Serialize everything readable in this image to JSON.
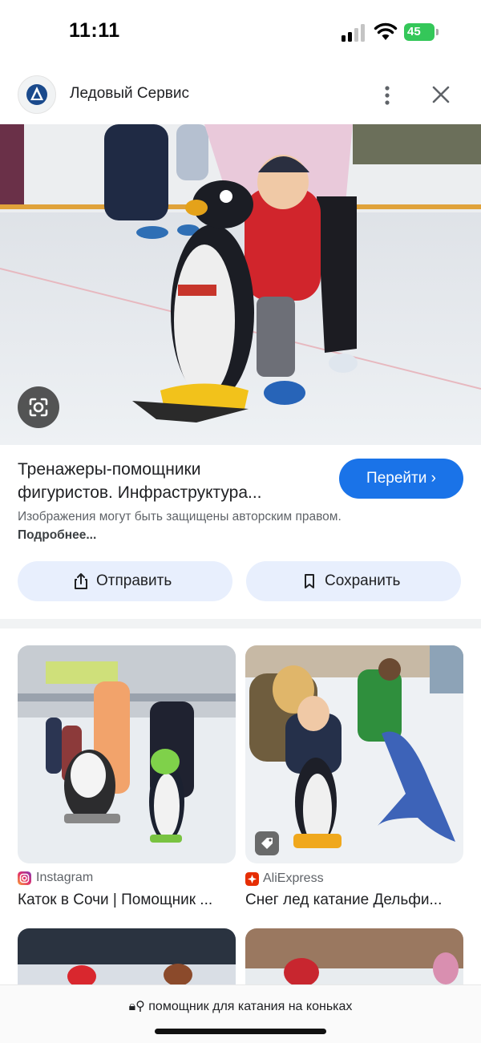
{
  "status_bar": {
    "time": "11:11",
    "battery": "45"
  },
  "header": {
    "site_name": "Ледовый Сервис"
  },
  "result": {
    "title_line1": "Тренажеры-помощники",
    "title_line2": "фигуристов. Инфраструктура...",
    "go_label": "Перейти",
    "copyright_text": "Изображения могут быть защищены авторским правом.",
    "learn_more": "Подробнее..."
  },
  "actions": {
    "share_label": "Отправить",
    "save_label": "Сохранить"
  },
  "related": [
    {
      "source": "Instagram",
      "title": "Каток в Сочи | Помощник ..."
    },
    {
      "source": "AliExpress",
      "title": "Снег лед катание Дельфи..."
    }
  ],
  "bottom": {
    "url": "помощник для катания на коньках"
  },
  "colors": {
    "accent": "#1a73e8",
    "pill_bg": "#e8effd",
    "battery": "#34c759"
  }
}
